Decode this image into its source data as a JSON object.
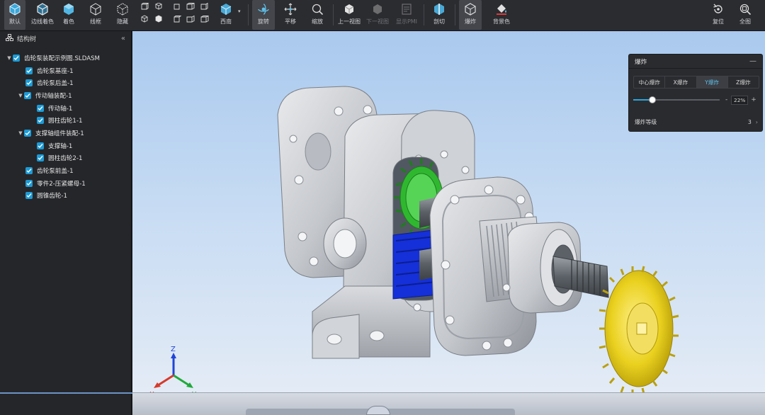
{
  "toolbar": {
    "buttons": [
      {
        "label": "默认",
        "icon": "cube-shaded-icon"
      },
      {
        "label": "边线着色",
        "icon": "cube-edges-icon"
      },
      {
        "label": "着色",
        "icon": "cube-solid-icon"
      },
      {
        "label": "线框",
        "icon": "cube-wireframe-icon"
      },
      {
        "label": "隐藏",
        "icon": "cube-hidden-lines-icon"
      },
      {
        "label": "西南",
        "icon": "iso-view-icon"
      },
      {
        "label": "旋转",
        "icon": "rotate-icon"
      },
      {
        "label": "平移",
        "icon": "pan-icon"
      },
      {
        "label": "缩放",
        "icon": "zoom-icon"
      },
      {
        "label": "上一视图",
        "icon": "previous-view-icon"
      },
      {
        "label": "下一视图",
        "icon": "next-view-icon"
      },
      {
        "label": "显示PMI",
        "icon": "pmi-icon"
      },
      {
        "label": "剖切",
        "icon": "section-icon"
      },
      {
        "label": "爆炸",
        "icon": "explode-icon"
      },
      {
        "label": "背景色",
        "icon": "paint-bucket-icon"
      },
      {
        "label": "复位",
        "icon": "reset-icon"
      },
      {
        "label": "全图",
        "icon": "zoom-fit-icon"
      }
    ]
  },
  "tree": {
    "title": "结构树",
    "items": [
      {
        "label": "齿轮泵装配示例图.SLDASM",
        "level": 0,
        "expanded": true
      },
      {
        "label": "齿轮泵基座-1",
        "level": 1
      },
      {
        "label": "齿轮泵后盖-1",
        "level": 1
      },
      {
        "label": "传动轴装配-1",
        "level": 1,
        "expanded": true
      },
      {
        "label": "传动轴-1",
        "level": 2
      },
      {
        "label": "圆柱齿轮1-1",
        "level": 2
      },
      {
        "label": "支撑轴组件装配-1",
        "level": 1,
        "expanded": true
      },
      {
        "label": "支撑轴-1",
        "level": 2
      },
      {
        "label": "圆柱齿轮2-1",
        "level": 2
      },
      {
        "label": "齿轮泵前盖-1",
        "level": 1
      },
      {
        "label": "零件2-压紧螺母-1",
        "level": 1
      },
      {
        "label": "圆锥齿轮-1",
        "level": 1
      }
    ]
  },
  "explode_panel": {
    "title": "爆炸",
    "tabs": [
      "中心爆炸",
      "X爆炸",
      "Y爆炸",
      "Z爆炸"
    ],
    "selected_tab": "Y爆炸",
    "percent_text": "22%",
    "percent_value": 22,
    "level_label": "爆炸等级",
    "level_value": "3"
  },
  "triad": {
    "x": "X",
    "y": "Y",
    "z": "Z"
  },
  "colors": {
    "accent": "#1d9bd6",
    "gear_green": "#2fb82f",
    "gear_blue": "#1530d8",
    "gear_yellow": "#ead11f",
    "part_gray": "#c9ccd1"
  }
}
